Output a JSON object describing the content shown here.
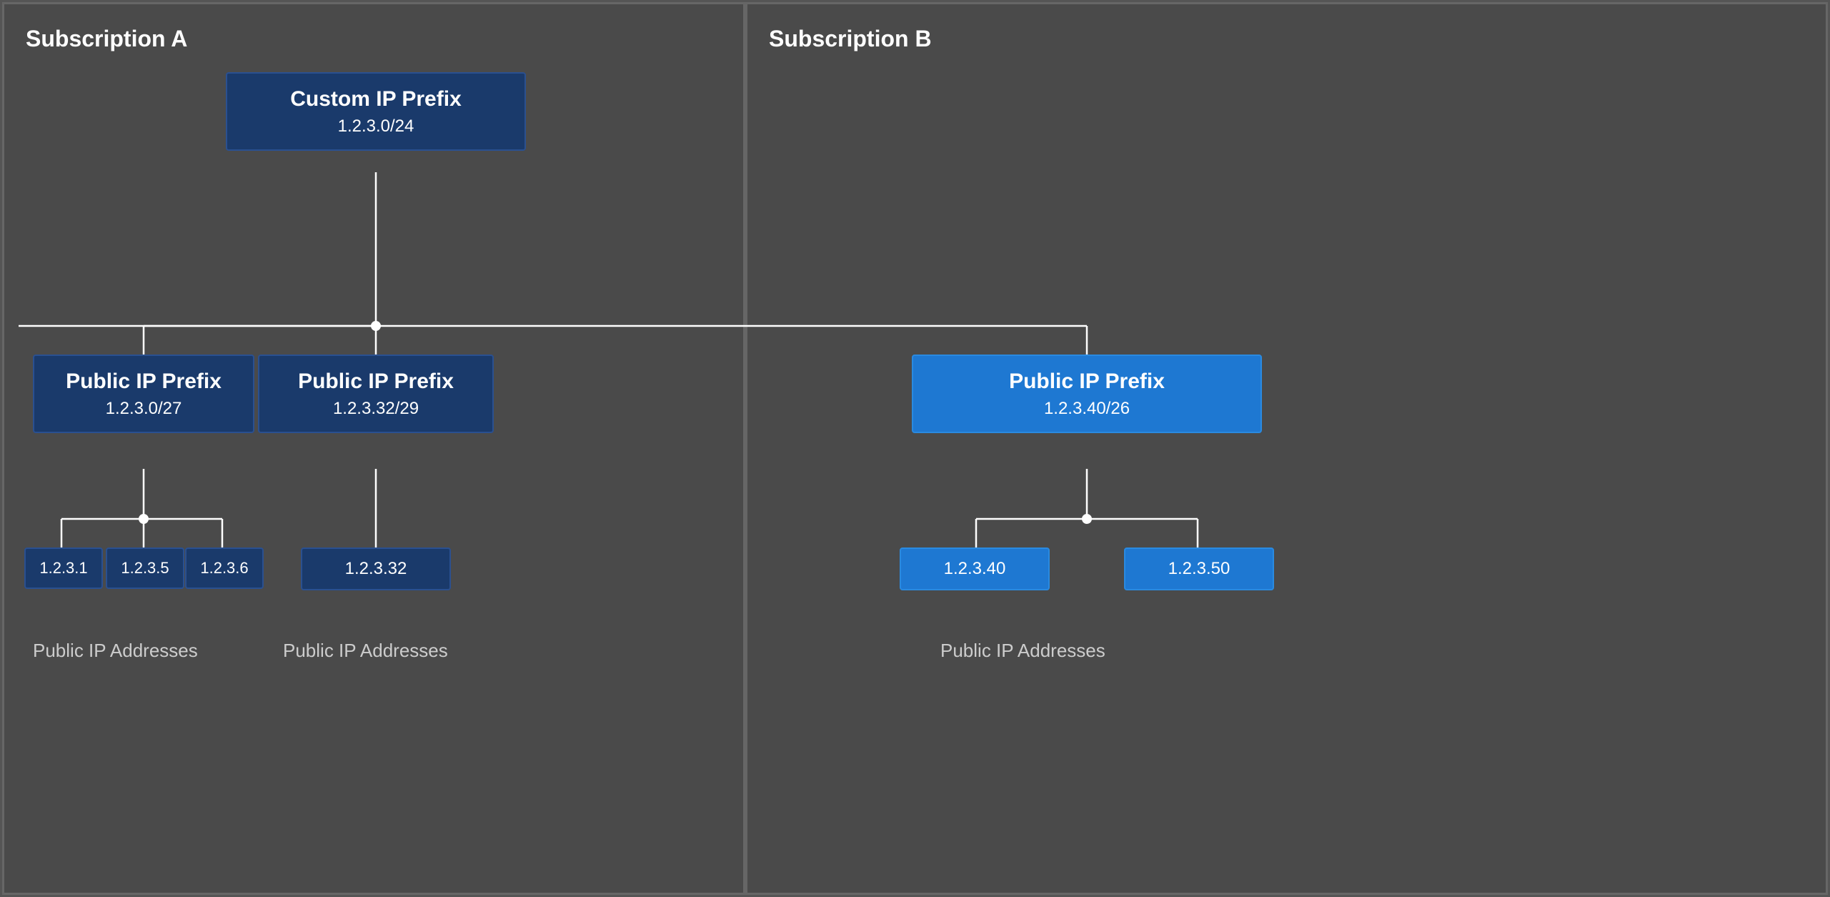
{
  "subscriptionA": {
    "label": "Subscription A",
    "customIPPrefix": {
      "title": "Custom IP Prefix",
      "subtitle": "1.2.3.0/24"
    },
    "prefixes": [
      {
        "title": "Public IP Prefix",
        "subtitle": "1.2.3.0/27",
        "addresses": [
          "1.2.3.1",
          "1.2.3.5",
          "1.2.3.6"
        ],
        "addressLabel": "Public IP Addresses"
      },
      {
        "title": "Public IP Prefix",
        "subtitle": "1.2.3.32/29",
        "addresses": [
          "1.2.3.32"
        ],
        "addressLabel": "Public IP Addresses"
      }
    ]
  },
  "subscriptionB": {
    "label": "Subscription B",
    "prefixes": [
      {
        "title": "Public IP Prefix",
        "subtitle": "1.2.3.40/26",
        "addresses": [
          "1.2.3.40",
          "1.2.3.50"
        ],
        "addressLabel": "Public IP Addresses"
      }
    ]
  }
}
